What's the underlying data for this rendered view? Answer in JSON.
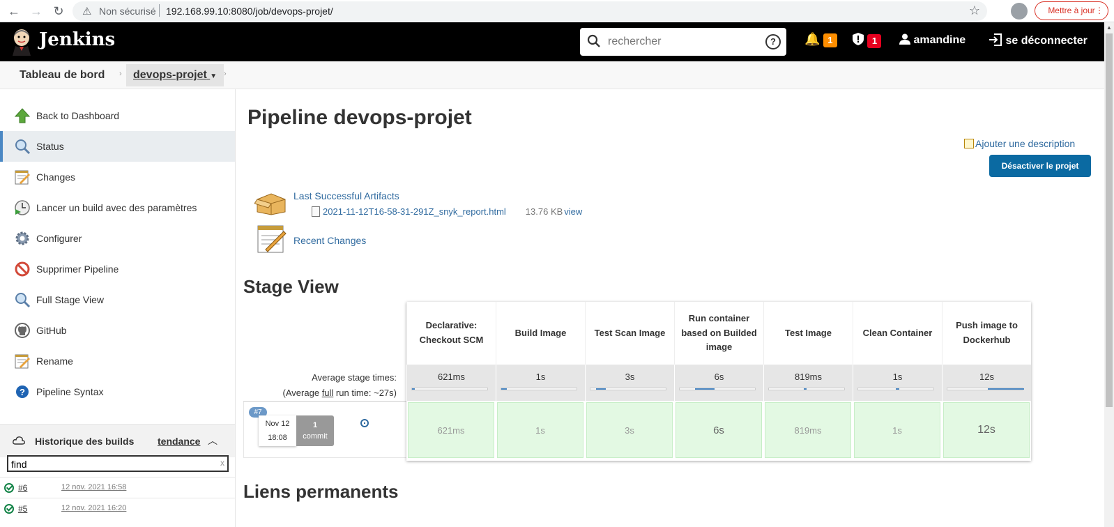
{
  "browser": {
    "insecure_label": "Non sécurisé",
    "url": "192.168.99.10:8080/job/devops-projet/",
    "update_label": "Mettre à jour"
  },
  "header": {
    "brand": "Jenkins",
    "search_placeholder": "rechercher",
    "notifications_count": "1",
    "security_count": "1",
    "user": "amandine",
    "logout": "se déconnecter"
  },
  "breadcrumb": {
    "dashboard": "Tableau de bord",
    "project": "devops-projet"
  },
  "side_panel": {
    "tasks": [
      {
        "label": "Back to Dashboard",
        "icon": "arrow-up-icon"
      },
      {
        "label": "Status",
        "icon": "search-icon"
      },
      {
        "label": "Changes",
        "icon": "notepad-icon"
      },
      {
        "label": "Lancer un build avec des paramètres",
        "icon": "clock-play-icon"
      },
      {
        "label": "Configurer",
        "icon": "gear-icon"
      },
      {
        "label": "Supprimer Pipeline",
        "icon": "no-entry-icon"
      },
      {
        "label": "Full Stage View",
        "icon": "search-icon"
      },
      {
        "label": "GitHub",
        "icon": "github-icon"
      },
      {
        "label": "Rename",
        "icon": "notepad-icon"
      },
      {
        "label": "Pipeline Syntax",
        "icon": "help-icon"
      }
    ],
    "history": {
      "title": "Historique des builds",
      "trend": "tendance",
      "find_value": "find",
      "find_clear": "x",
      "builds": [
        {
          "number": "#6",
          "date": "12 nov. 2021 16:58"
        },
        {
          "number": "#5",
          "date": "12 nov. 2021 16:20"
        }
      ]
    }
  },
  "main": {
    "title": "Pipeline devops-projet",
    "add_description": "Ajouter une description",
    "disable_button": "Désactiver le projet",
    "artifacts_link": "Last Successful Artifacts",
    "artifact_file": "2021-11-12T16-58-31-291Z_snyk_report.html",
    "artifact_size": "13.76 KB",
    "artifact_view": "view",
    "recent_changes": "Recent Changes",
    "stage_view_title": "Stage View",
    "permalinks_title": "Liens permanents"
  },
  "stage_view": {
    "avg_label": "Average stage times:",
    "avg_full_prefix": "(Average ",
    "avg_full_word": "full",
    "avg_full_suffix": " run time: ~27s)",
    "stages": [
      {
        "name": "Declarative: Checkout SCM",
        "avg": "621ms",
        "cell": "621ms"
      },
      {
        "name": "Build Image",
        "avg": "1s",
        "cell": "1s"
      },
      {
        "name": "Test Scan Image",
        "avg": "3s",
        "cell": "3s"
      },
      {
        "name": "Run container based on Builded image",
        "avg": "6s",
        "cell": "6s"
      },
      {
        "name": "Test Image",
        "avg": "819ms",
        "cell": "819ms"
      },
      {
        "name": "Clean Container",
        "avg": "1s",
        "cell": "1s"
      },
      {
        "name": "Push image to Dockerhub",
        "avg": "12s",
        "cell": "12s"
      }
    ],
    "build": {
      "badge": "#7",
      "month_day": "Nov 12",
      "time": "18:08",
      "commits": "1",
      "commit_word": "commit"
    }
  },
  "colors": {
    "header_bg": "#000000",
    "link": "#2f6a9f",
    "primary_button": "#0b6aa2",
    "stage_success": "#e3f9e3",
    "notification_badge": "#fe8e00",
    "security_badge": "#e6001f"
  }
}
